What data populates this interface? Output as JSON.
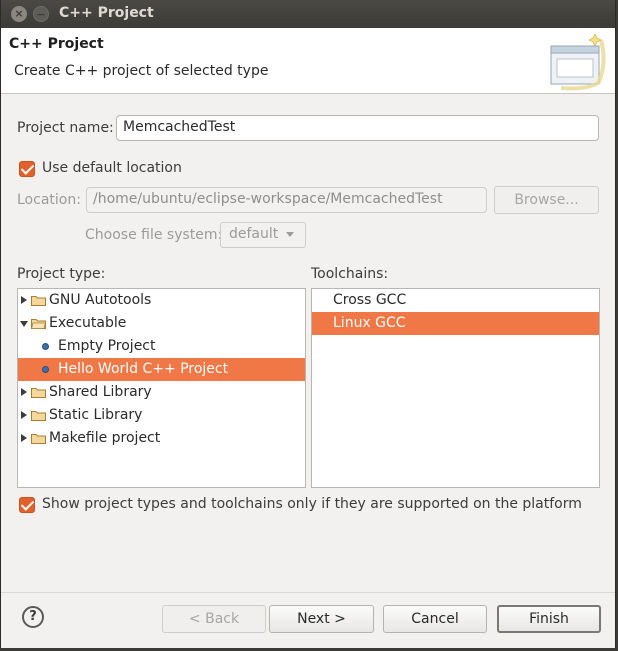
{
  "window": {
    "title": "C++ Project"
  },
  "banner": {
    "title": "C++ Project",
    "description": "Create C++ project of selected type"
  },
  "form": {
    "project_name_label": "Project name:",
    "project_name_value": "MemcachedTest",
    "use_default_location_label": "Use default location",
    "use_default_location_checked": true,
    "location_label": "Location:",
    "location_value": "/home/ubuntu/eclipse-workspace/MemcachedTest",
    "browse_label": "Browse...",
    "file_system_label": "Choose file system:",
    "file_system_value": "default"
  },
  "project_types": {
    "label": "Project type:",
    "items": [
      {
        "label": "GNU Autotools",
        "kind": "folder",
        "state": "collapsed",
        "selected": false
      },
      {
        "label": "Executable",
        "kind": "folder",
        "state": "expanded",
        "selected": false
      },
      {
        "label": "Empty Project",
        "kind": "item",
        "selected": false
      },
      {
        "label": "Hello World C++ Project",
        "kind": "item",
        "selected": true
      },
      {
        "label": "Shared Library",
        "kind": "folder",
        "state": "collapsed",
        "selected": false
      },
      {
        "label": "Static Library",
        "kind": "folder",
        "state": "collapsed",
        "selected": false
      },
      {
        "label": "Makefile project",
        "kind": "folder",
        "state": "collapsed",
        "selected": false
      }
    ]
  },
  "toolchains": {
    "label": "Toolchains:",
    "items": [
      {
        "label": "Cross GCC",
        "selected": false
      },
      {
        "label": "Linux GCC",
        "selected": true
      }
    ]
  },
  "filter": {
    "label": "Show project types and toolchains only if they are supported on the platform",
    "checked": true
  },
  "buttons": {
    "help": "?",
    "back": "< Back",
    "next": "Next >",
    "cancel": "Cancel",
    "finish": "Finish"
  },
  "colors": {
    "accent": "#f07746",
    "checkbox": "#e0612b",
    "titlebar": "#3c3b37"
  }
}
